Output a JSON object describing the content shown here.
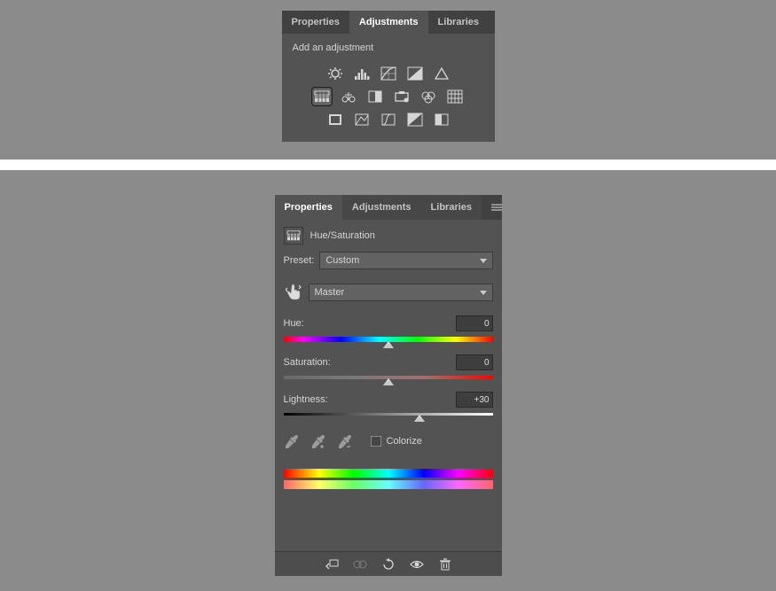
{
  "tabs": {
    "properties": "Properties",
    "adjustments": "Adjustments",
    "libraries": "Libraries"
  },
  "adjustments": {
    "section_label": "Add an adjustment",
    "selected_tool": "hue-saturation-icon"
  },
  "properties_panel": {
    "adjustment_name": "Hue/Saturation",
    "preset_label": "Preset:",
    "preset_value": "Custom",
    "channel_value": "Master",
    "hue": {
      "label": "Hue:",
      "value": "0",
      "position": 50
    },
    "saturation": {
      "label": "Saturation:",
      "value": "0",
      "position": 50
    },
    "lightness": {
      "label": "Lightness:",
      "value": "+30",
      "position": 65
    },
    "colorize_label": "Colorize"
  }
}
